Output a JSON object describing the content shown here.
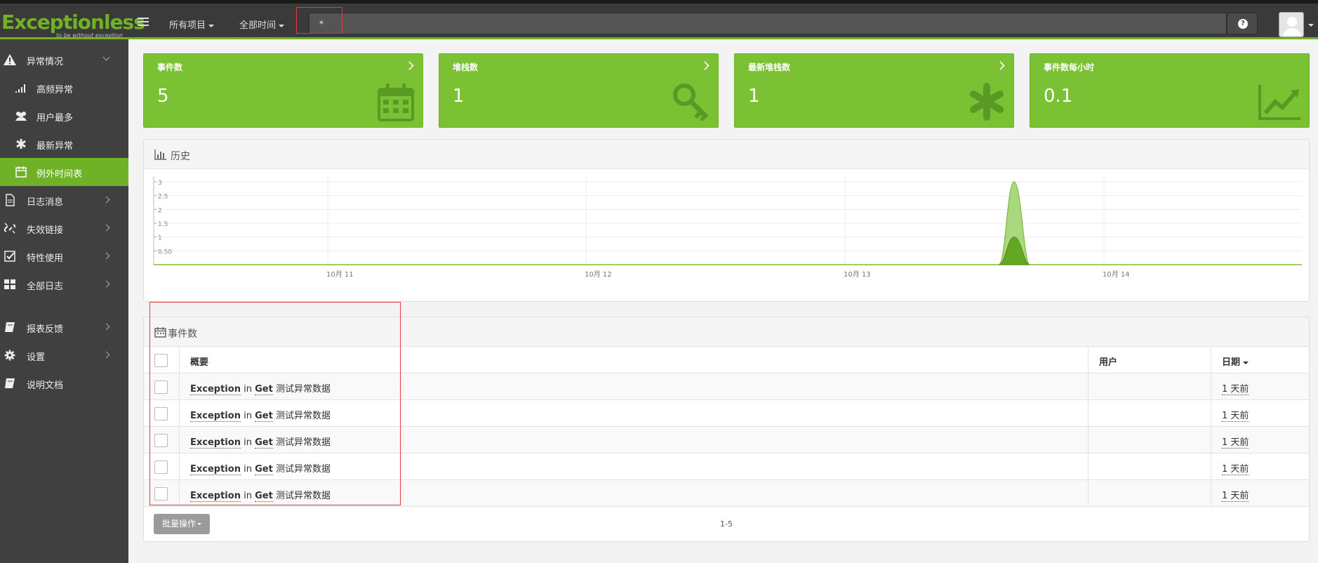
{
  "brand": {
    "logo_main": "Exceptionless",
    "logo_tag": "to be without exception",
    "accent": "#6fb228"
  },
  "nav": {
    "project_filter": "所有项目",
    "time_filter": "全部时间",
    "search_value": "*",
    "help_icon": "question-circle-icon"
  },
  "sidebar": {
    "items": [
      {
        "label": "异常情况",
        "icon": "warning-icon",
        "expanded": true
      },
      {
        "label": "高频异常",
        "icon": "signal-icon",
        "sub": true
      },
      {
        "label": "用户最多",
        "icon": "users-icon",
        "sub": true
      },
      {
        "label": "最新异常",
        "icon": "asterisk-icon",
        "sub": true
      },
      {
        "label": "例外时间表",
        "icon": "calendar-icon",
        "sub": true,
        "active": true
      },
      {
        "label": "日志消息",
        "icon": "file-icon"
      },
      {
        "label": "失效链接",
        "icon": "unlink-icon"
      },
      {
        "label": "特性使用",
        "icon": "check-square-icon"
      },
      {
        "label": "全部日志",
        "icon": "th-large-icon"
      },
      {
        "label": "报表反馈",
        "icon": "book-icon"
      },
      {
        "label": "设置",
        "icon": "gear-icon"
      },
      {
        "label": "说明文档",
        "icon": "book-icon"
      }
    ]
  },
  "tiles": [
    {
      "title": "事件数",
      "value": "5",
      "icon": "calendar-icon"
    },
    {
      "title": "堆栈数",
      "value": "1",
      "icon": "key-icon"
    },
    {
      "title": "最新堆栈数",
      "value": "1",
      "icon": "asterisk-icon"
    },
    {
      "title": "事件数每小时",
      "value": "0.1",
      "icon": "line-chart-icon"
    }
  ],
  "history": {
    "title": "历史"
  },
  "chart_data": {
    "type": "area",
    "title": "历史",
    "x_tick_labels": [
      "10月 11",
      "10月 12",
      "10月 13",
      "10月 14"
    ],
    "y_tick_labels": [
      "0.50",
      "1",
      "1.5",
      "2",
      "2.5",
      "3"
    ],
    "ylim": [
      0,
      3.2
    ],
    "grid": true,
    "series": [
      {
        "values": [
          0,
          0,
          0,
          0,
          0,
          0,
          0,
          0,
          0,
          3,
          0,
          0,
          0,
          0
        ]
      },
      {
        "values": [
          0,
          0,
          0,
          0,
          0,
          0,
          0,
          0,
          0,
          1,
          0,
          0,
          0,
          0
        ]
      }
    ]
  },
  "events_panel": {
    "title": "事件数",
    "headers": {
      "summary": "概要",
      "user": "用户",
      "date": "日期"
    },
    "rows": [
      {
        "type": "Exception",
        "in": "in",
        "method": "Get",
        "message": "测试异常数据",
        "date": "1 天前"
      },
      {
        "type": "Exception",
        "in": "in",
        "method": "Get",
        "message": "测试异常数据",
        "date": "1 天前"
      },
      {
        "type": "Exception",
        "in": "in",
        "method": "Get",
        "message": "测试异常数据",
        "date": "1 天前"
      },
      {
        "type": "Exception",
        "in": "in",
        "method": "Get",
        "message": "测试异常数据",
        "date": "1 天前"
      },
      {
        "type": "Exception",
        "in": "in",
        "method": "Get",
        "message": "测试异常数据",
        "date": "1 天前"
      }
    ],
    "bulk_label": "批量操作",
    "pager": "1-5"
  }
}
